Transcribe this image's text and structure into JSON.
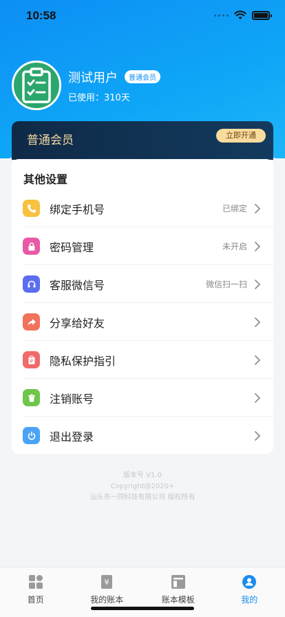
{
  "status": {
    "time": "10:58"
  },
  "profile": {
    "name": "测试用户",
    "member_tag": "普通会员",
    "used": "已使用：310天"
  },
  "vip": {
    "title": "普通会员",
    "button": "立即开通"
  },
  "settings": {
    "title": "其他设置",
    "items": [
      {
        "label": "绑定手机号",
        "value": "已绑定",
        "color": "#f7c23e",
        "icon": "phone-icon"
      },
      {
        "label": "密码管理",
        "value": "未开启",
        "color": "#e85aa6",
        "icon": "lock-icon"
      },
      {
        "label": "客服微信号",
        "value": "微信扫一扫",
        "color": "#5a6ef0",
        "icon": "headset-icon"
      },
      {
        "label": "分享给好友",
        "value": "",
        "color": "#f1735c",
        "icon": "share-icon"
      },
      {
        "label": "隐私保护指引",
        "value": "",
        "color": "#f06a6a",
        "icon": "clipboard-icon"
      },
      {
        "label": "注销账号",
        "value": "",
        "color": "#6fc64a",
        "icon": "trash-icon"
      },
      {
        "label": "退出登录",
        "value": "",
        "color": "#4aa3f5",
        "icon": "power-icon"
      }
    ]
  },
  "footer": {
    "version": "版本号 V1.0",
    "copyright": "Copyright@2020+",
    "company": "汕头市一同科技有限公司 版权所有"
  },
  "tabs": [
    {
      "label": "首页",
      "icon": "home-grid-icon"
    },
    {
      "label": "我的账本",
      "icon": "ledger-icon"
    },
    {
      "label": "账本模板",
      "icon": "template-icon"
    },
    {
      "label": "我的",
      "icon": "user-icon"
    }
  ],
  "colors": {
    "accent": "#1a8cf0",
    "header": "#0d8ff4",
    "vip_gold": "#f8dc9d"
  }
}
